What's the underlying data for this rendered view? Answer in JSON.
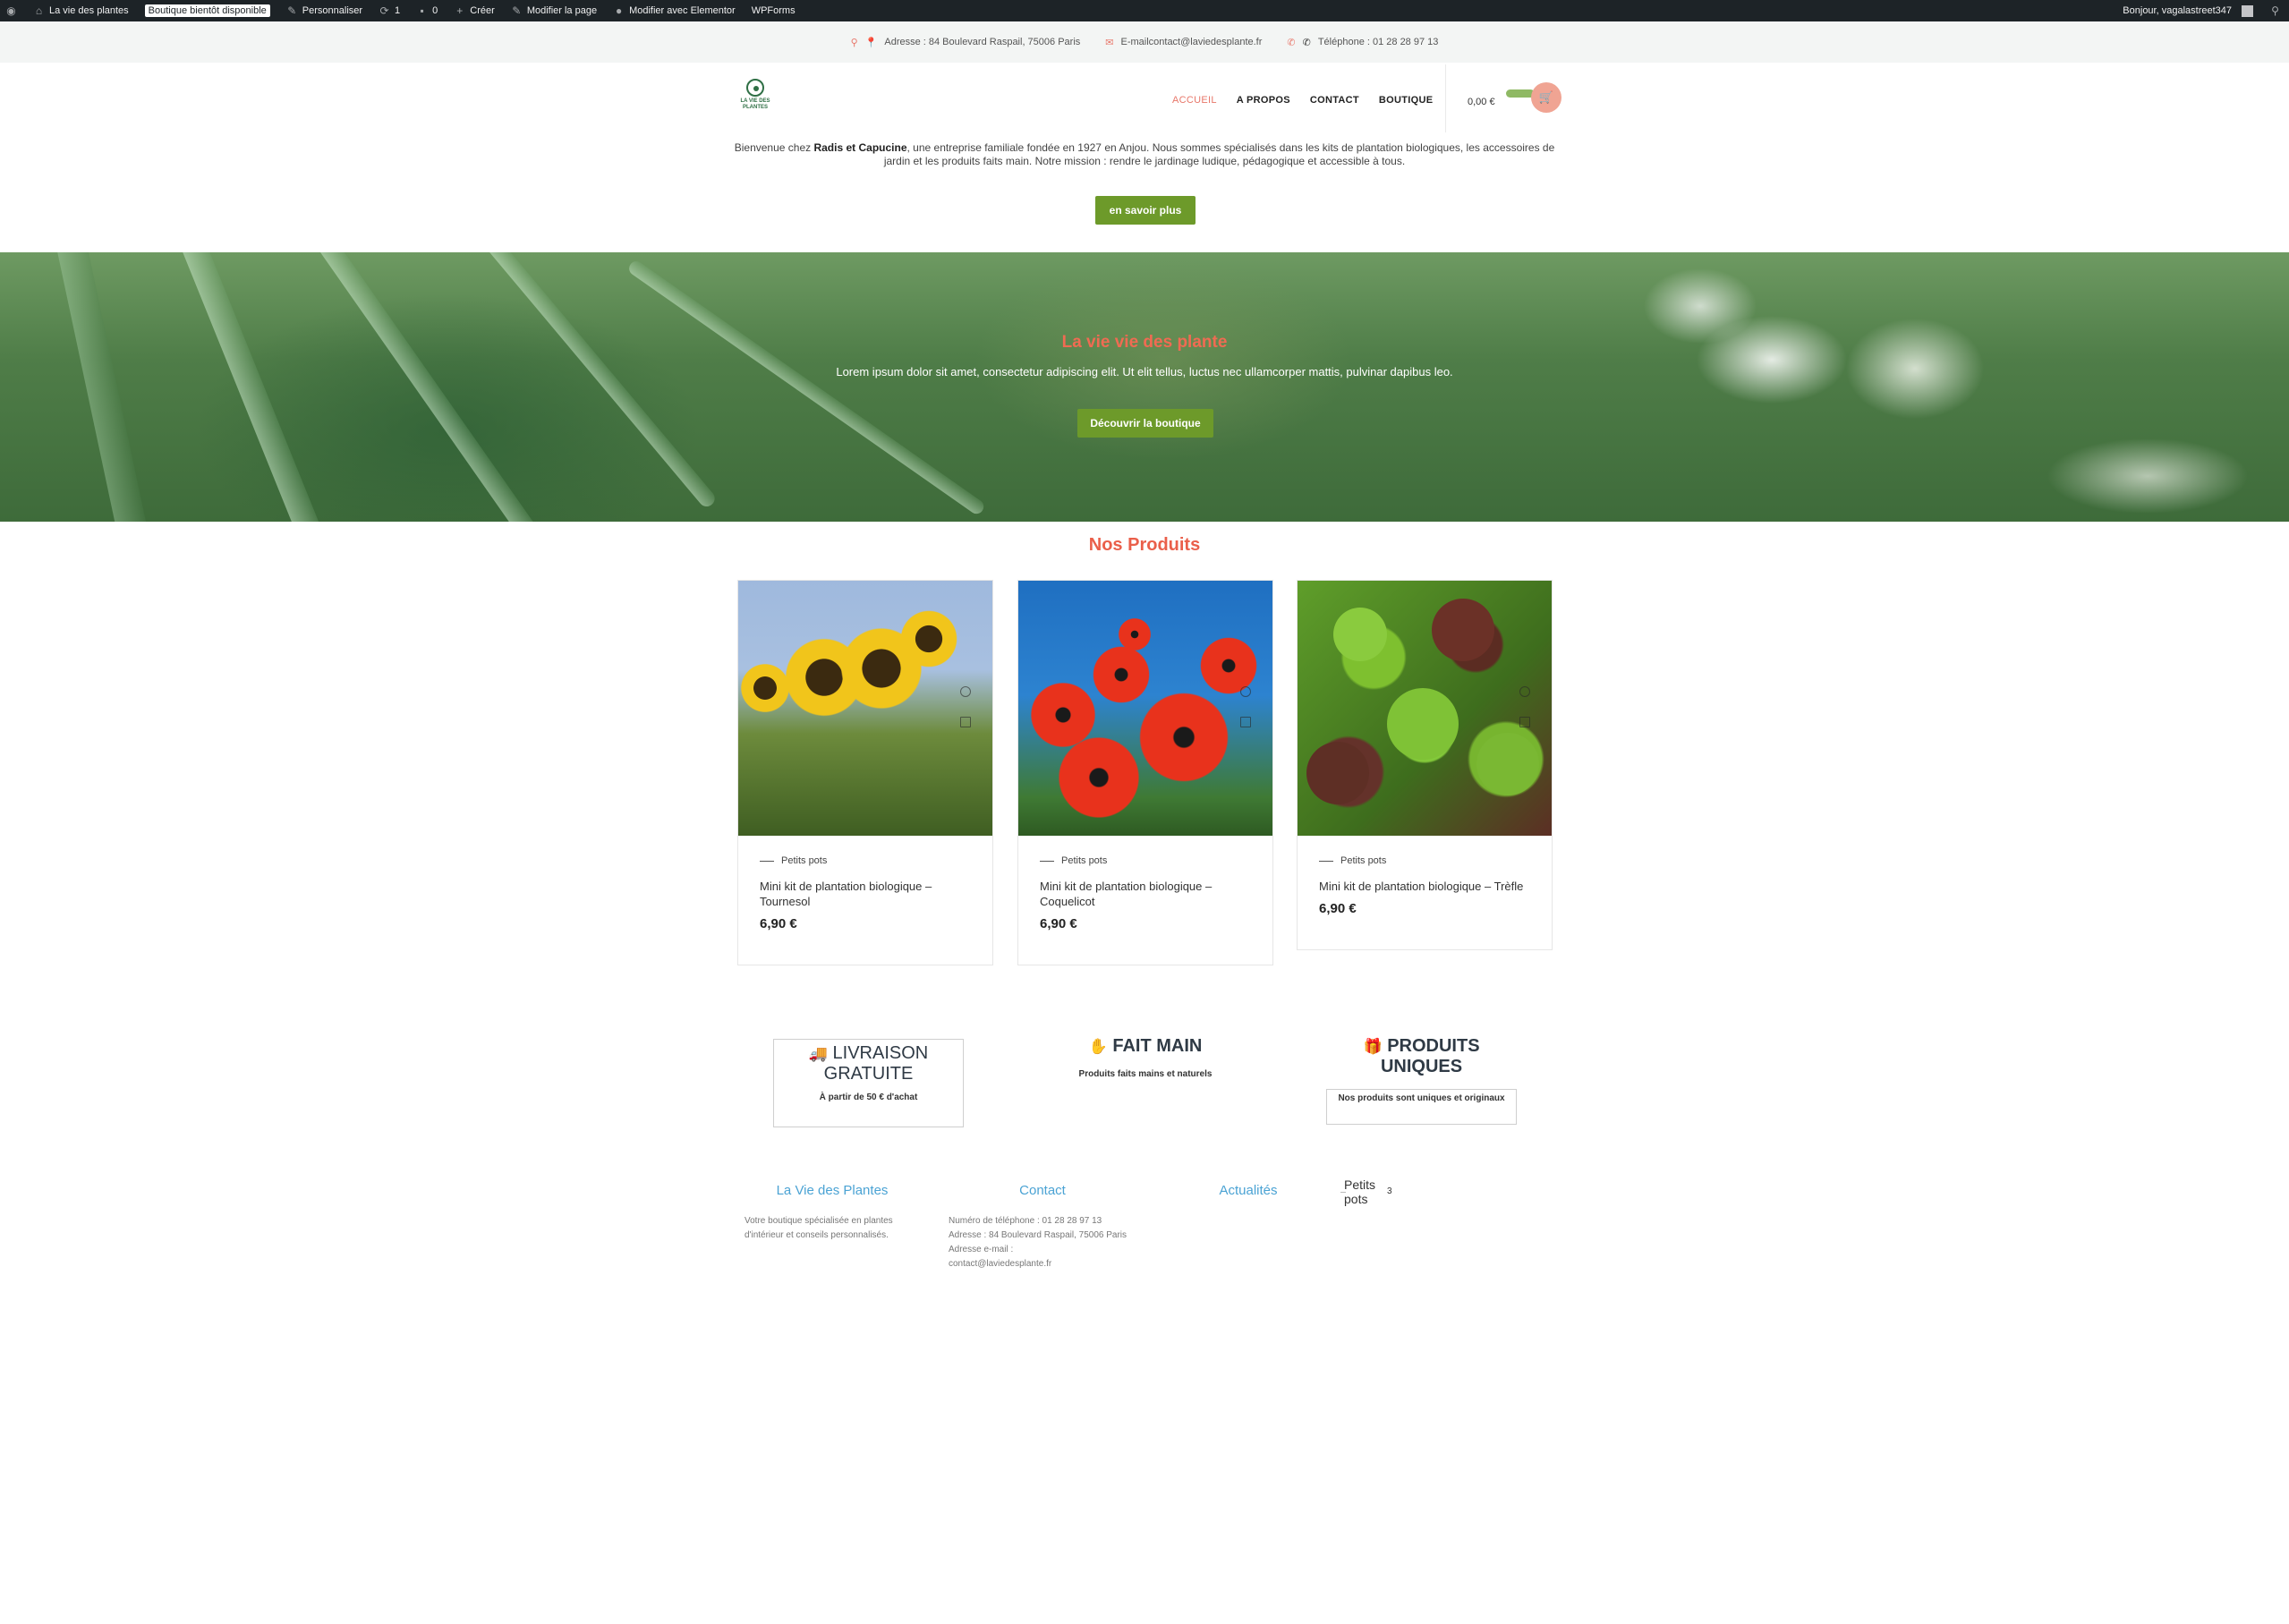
{
  "adminbar": {
    "site_name": "La vie des plantes",
    "coming_soon_badge": "Boutique bientôt disponible",
    "customize": "Personnaliser",
    "updates_count": "1",
    "comments_count": "0",
    "create": "Créer",
    "edit_page": "Modifier la page",
    "edit_elementor": "Modifier avec Elementor",
    "wpforms": "WPForms",
    "greeting": "Bonjour, vagalastreet347"
  },
  "topbar": {
    "address": "Adresse : 84 Boulevard Raspail, 75006 Paris",
    "email": "E-mailcontact@laviedesplante.fr",
    "phone": "Téléphone : 01 28 28 97 13"
  },
  "header": {
    "logo_text": "LA VIE DES PLANTES",
    "nav": [
      {
        "label": "ACCUEIL",
        "active": true
      },
      {
        "label": "A PROPOS",
        "active": false
      },
      {
        "label": "CONTACT",
        "active": false
      },
      {
        "label": "BOUTIQUE",
        "active": false
      }
    ],
    "cart_total": "0,00 €",
    "accent_color": "#e8776a"
  },
  "intro": {
    "text_before": "Bienvenue chez ",
    "brand": "Radis et Capucine",
    "text_after": ", une entreprise familiale fondée en 1927 en Anjou. Nous sommes spécialisés dans les kits de plantation biologiques, les accessoires de jardin et les produits faits main. Notre mission : rendre le jardinage ludique, pédagogique et accessible à tous.",
    "button": "en savoir plus"
  },
  "hero": {
    "title": "La vie vie des plante",
    "text": "Lorem ipsum dolor sit amet, consectetur adipiscing elit. Ut elit tellus, luctus nec ullamcorper mattis, pulvinar dapibus leo.",
    "button": "Découvrir la boutique"
  },
  "products": {
    "title": "Nos Produits",
    "items": [
      {
        "category": "Petits pots",
        "name": "Mini kit de plantation biologique – Tournesol",
        "price": "6,90 €",
        "image": "sunflower"
      },
      {
        "category": "Petits pots",
        "name": "Mini kit de plantation biologique – Coquelicot",
        "price": "6,90 €",
        "image": "poppy"
      },
      {
        "category": "Petits pots",
        "name": "Mini kit de plantation biologique – Trèfle",
        "price": "6,90 €",
        "image": "clover"
      }
    ]
  },
  "features": [
    {
      "icon": "truck-icon",
      "emoji": "🚚",
      "title": "LIVRAISON GRATUITE",
      "subtitle": "À partir de 50 € d'achat"
    },
    {
      "icon": "hand-icon",
      "emoji": "✋",
      "title": "FAIT MAIN",
      "subtitle": "Produits faits mains et naturels"
    },
    {
      "icon": "gift-icon",
      "emoji": "🎁",
      "title": "PRODUITS UNIQUES",
      "subtitle": "Nos produits sont uniques et originaux"
    }
  ],
  "footer": {
    "about_title": "La Vie des Plantes",
    "about_text": "Votre boutique spécialisée en plantes d'intérieur et conseils personnalisés.",
    "contact_title": "Contact",
    "contact_phone": "Numéro de téléphone : 01 28 28 97 13",
    "contact_address": "Adresse : 84 Boulevard Raspail, 75006 Paris",
    "contact_email_label": "Adresse e-mail :",
    "contact_email": "contact@laviedesplante.fr",
    "news_title": "Actualités",
    "category_name": "Petits pots",
    "category_count": "3"
  }
}
